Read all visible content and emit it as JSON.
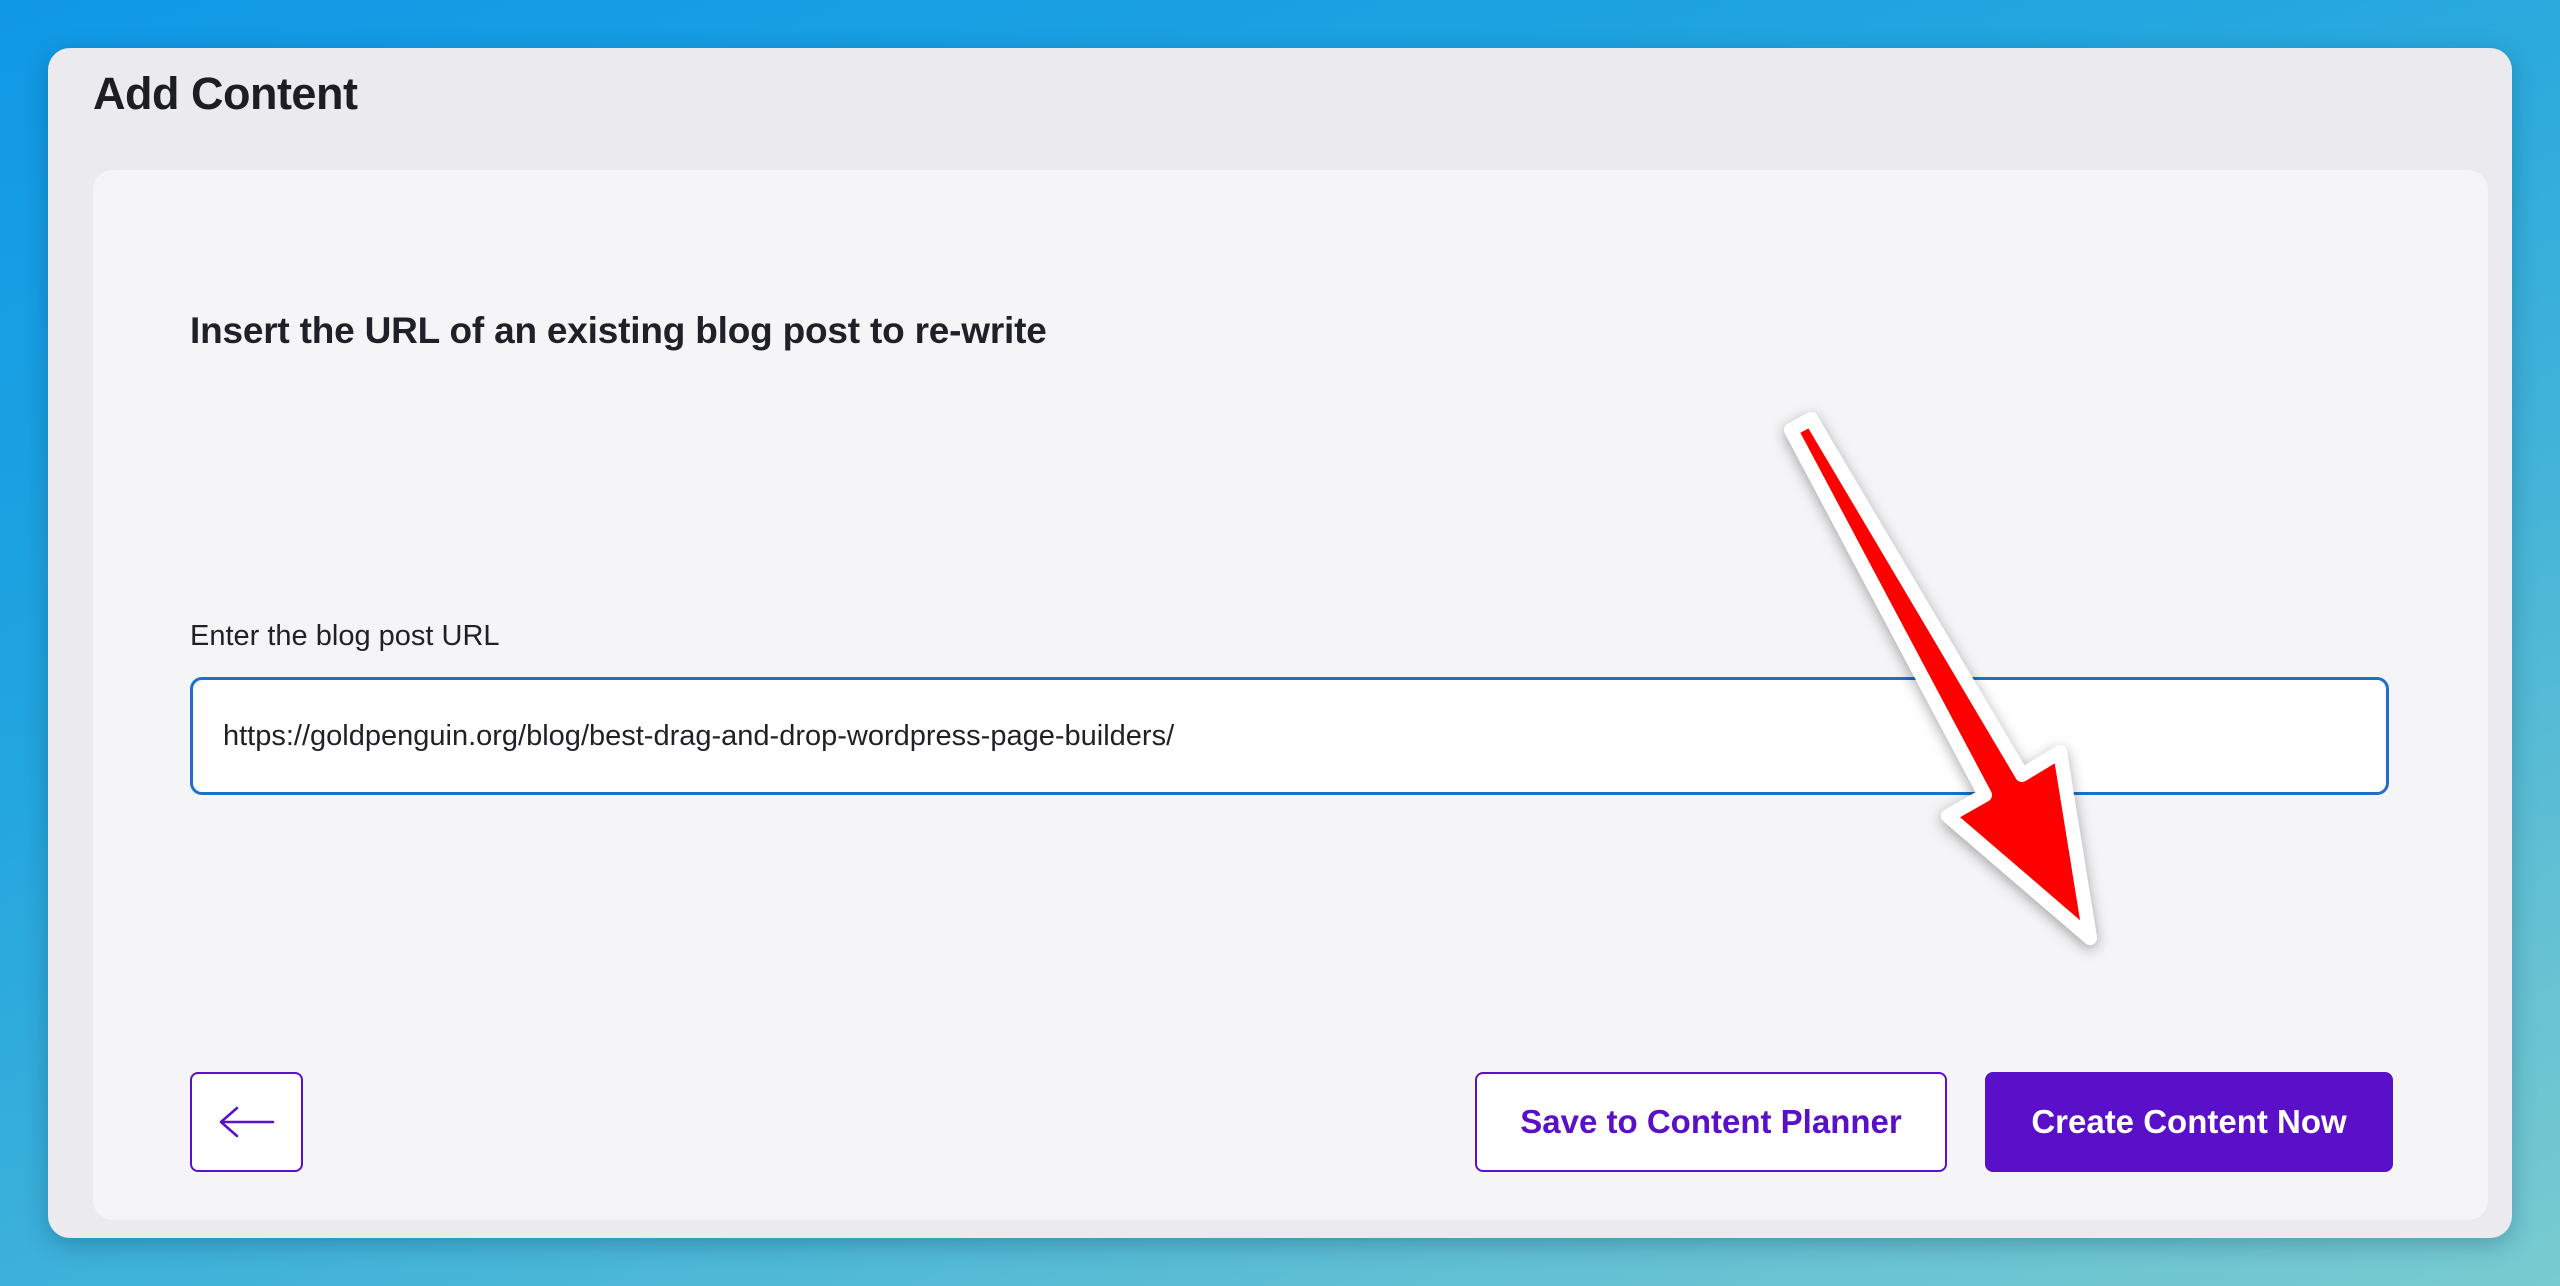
{
  "page": {
    "title": "Add Content"
  },
  "form": {
    "heading": "Insert the URL of an existing blog post to re-write",
    "url_label": "Enter the blog post URL",
    "url_value": "https://goldpenguin.org/blog/best-drag-and-drop-wordpress-page-builders/"
  },
  "actions": {
    "back_icon": "arrow-left-icon",
    "save_label": "Save to Content Planner",
    "create_label": "Create Content Now"
  },
  "annotation": {
    "icon": "red-arrow-pointer",
    "color": "#ff0000"
  },
  "colors": {
    "accent": "#5a0fc8",
    "input_border": "#1f6fc9",
    "background_gradient": [
      "#0f98e6",
      "#78cbd0"
    ]
  }
}
